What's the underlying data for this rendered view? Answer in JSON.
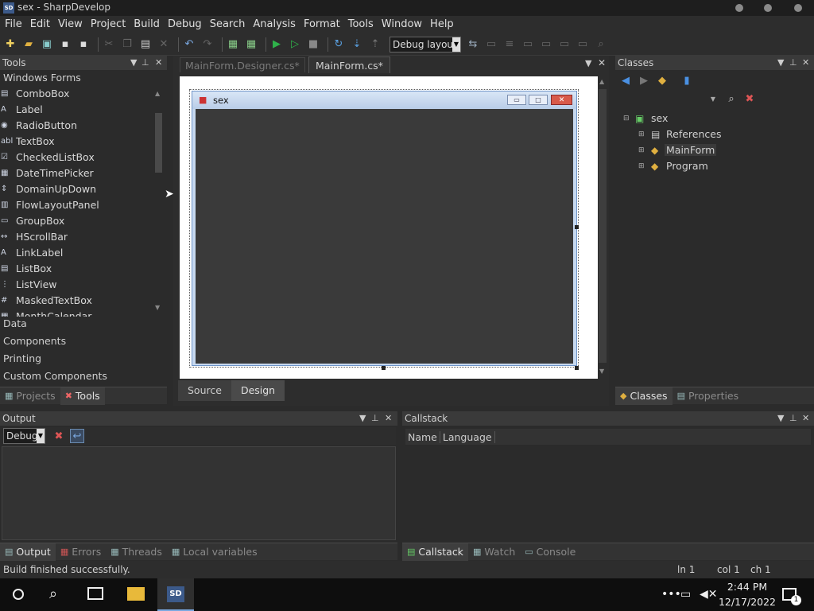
{
  "window": {
    "title": "sex - SharpDevelop",
    "app_icon": "SD"
  },
  "menu": [
    "File",
    "Edit",
    "View",
    "Project",
    "Build",
    "Debug",
    "Search",
    "Analysis",
    "Format",
    "Tools",
    "Window",
    "Help"
  ],
  "toolbar": {
    "layout_combo": "Debug layout"
  },
  "tools_panel": {
    "title": "Tools",
    "top_category": "Windows Forms",
    "items": [
      "ComboBox",
      "Label",
      "RadioButton",
      "TextBox",
      "CheckedListBox",
      "DateTimePicker",
      "DomainUpDown",
      "FlowLayoutPanel",
      "GroupBox",
      "HScrollBar",
      "LinkLabel",
      "ListBox",
      "ListView",
      "MaskedTextBox",
      "MonthCalendar"
    ],
    "item_icons": [
      "combobox-icon",
      "label-icon",
      "radiobutton-icon",
      "textbox-icon",
      "checkedlistbox-icon",
      "datetimepicker-icon",
      "domainupdown-icon",
      "flowlayoutpanel-icon",
      "groupbox-icon",
      "hscrollbar-icon",
      "linklabel-icon",
      "listbox-icon",
      "listview-icon",
      "maskedtextbox-icon",
      "monthcalendar-icon"
    ],
    "item_glyphs": [
      "▤",
      "A",
      "◉",
      "abl",
      "☑",
      "▦",
      "⇕",
      "▥",
      "▭",
      "↔",
      "A",
      "▤",
      "⋮",
      "#",
      "▦"
    ],
    "categories": [
      "Data",
      "Components",
      "Printing",
      "Custom Components"
    ],
    "tabs": [
      "Projects",
      "Tools"
    ]
  },
  "designer": {
    "tabs": [
      "MainForm.Designer.cs*",
      "MainForm.cs*"
    ],
    "form_title": "sex",
    "bottom_tabs": [
      "Source",
      "Design"
    ]
  },
  "classes_panel": {
    "title": "Classes",
    "tree_root": "sex",
    "tree_children": [
      "References",
      "MainForm",
      "Program"
    ],
    "tabs": [
      "Classes",
      "Properties"
    ]
  },
  "output_panel": {
    "title": "Output",
    "combo": "Debug",
    "tabs": [
      "Output",
      "Errors",
      "Threads",
      "Local variables"
    ]
  },
  "callstack_panel": {
    "title": "Callstack",
    "columns": [
      "Name",
      "Language"
    ],
    "tabs": [
      "Callstack",
      "Watch",
      "Console"
    ]
  },
  "status": {
    "message": "Build finished successfully.",
    "line": "ln 1",
    "col": "col 1",
    "ch": "ch 1"
  },
  "taskbar": {
    "time": "2:44 PM",
    "date": "12/17/2022",
    "notification_count": "1",
    "app_label": "SD"
  },
  "colors": {
    "accent": "#2b6fc4",
    "panel": "#2b2b2b",
    "form_border": "#6e94c8"
  }
}
